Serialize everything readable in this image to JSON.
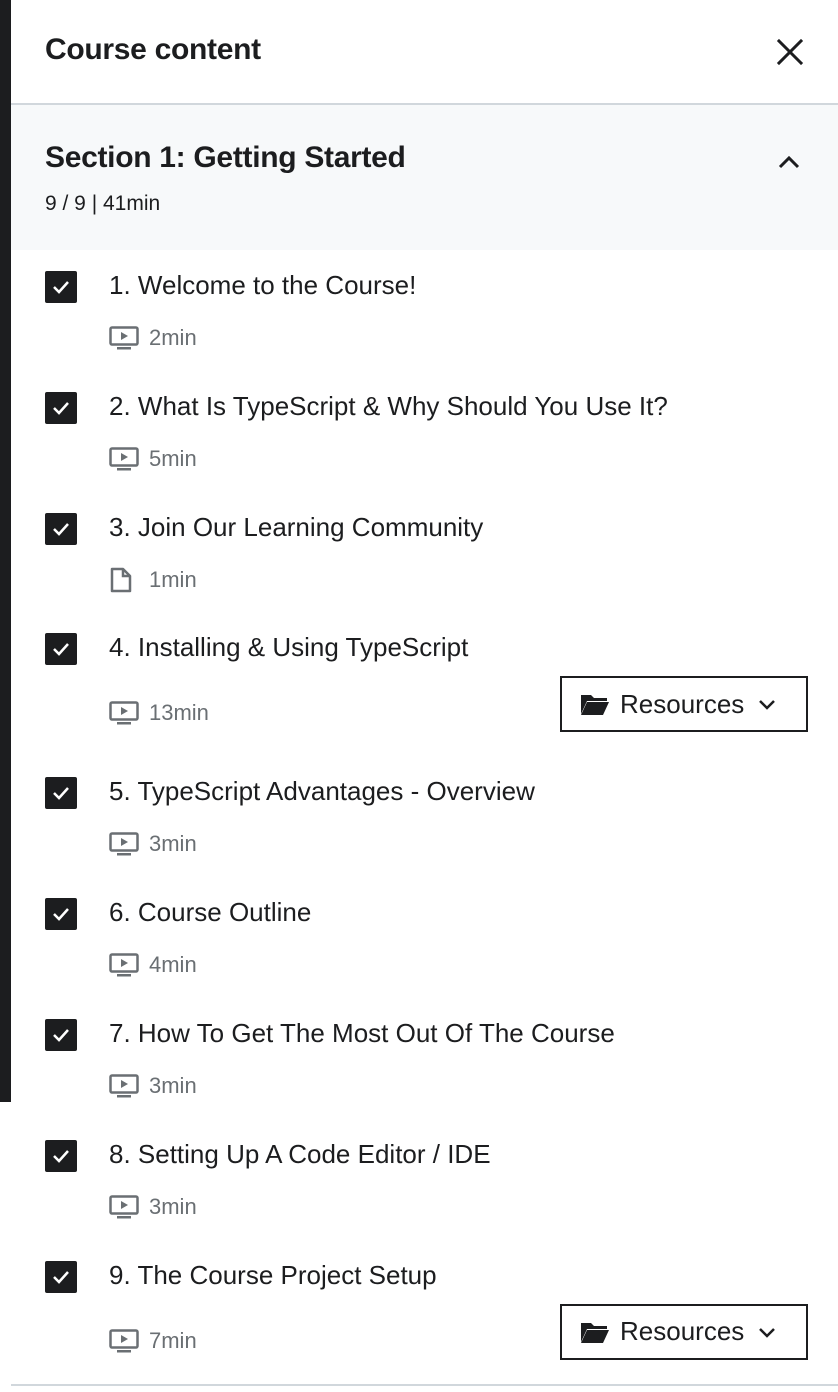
{
  "header": {
    "title": "Course content"
  },
  "section": {
    "title": "Section 1: Getting Started",
    "meta": "9 / 9 | 41min"
  },
  "lectures": [
    {
      "title": "1. Welcome to the Course!",
      "duration": "2min",
      "type": "video-icon",
      "completed": true,
      "resources": false
    },
    {
      "title": "2. What Is TypeScript & Why Should You Use It?",
      "duration": "5min",
      "type": "video-icon",
      "completed": true,
      "resources": false
    },
    {
      "title": "3. Join Our Learning Community",
      "duration": "1min",
      "type": "file-icon",
      "completed": true,
      "resources": false
    },
    {
      "title": "4. Installing & Using TypeScript",
      "duration": "13min",
      "type": "video-icon",
      "completed": true,
      "resources": true
    },
    {
      "title": "5. TypeScript Advantages - Overview",
      "duration": "3min",
      "type": "video-icon",
      "completed": true,
      "resources": false
    },
    {
      "title": "6. Course Outline",
      "duration": "4min",
      "type": "video-icon",
      "completed": true,
      "resources": false
    },
    {
      "title": "7. How To Get The Most Out Of The Course",
      "duration": "3min",
      "type": "video-icon",
      "completed": true,
      "resources": false
    },
    {
      "title": "8. Setting Up A Code Editor / IDE",
      "duration": "3min",
      "type": "video-icon",
      "completed": true,
      "resources": false
    },
    {
      "title": "9. The Course Project Setup",
      "duration": "7min",
      "type": "video-icon",
      "completed": true,
      "resources": true
    }
  ],
  "resources_label": "Resources",
  "colors": {
    "text": "#1c1d1f",
    "muted": "#6a6f73",
    "border": "#d1d7dc",
    "section_bg": "#f7f9fa"
  }
}
